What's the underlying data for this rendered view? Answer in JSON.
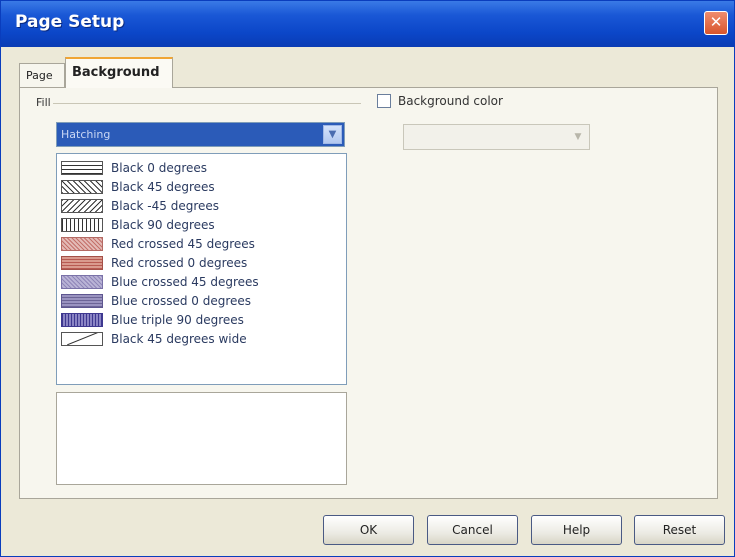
{
  "window": {
    "title": "Page Setup",
    "close_glyph": "✕"
  },
  "tabs": [
    {
      "label": "Page",
      "active": false
    },
    {
      "label": "Background",
      "active": true
    }
  ],
  "fill": {
    "label": "Fill",
    "type_selected": "Hatching",
    "items": [
      {
        "label": "Black 0 degrees",
        "pattern": "black-0"
      },
      {
        "label": "Black 45 degrees",
        "pattern": "black-45"
      },
      {
        "label": "Black -45 degrees",
        "pattern": "black-minus-45"
      },
      {
        "label": "Black 90 degrees",
        "pattern": "black-90"
      },
      {
        "label": "Red crossed 45 degrees",
        "pattern": "red-crossed-45"
      },
      {
        "label": "Red crossed 0 degrees",
        "pattern": "red-crossed-0"
      },
      {
        "label": "Blue crossed 45 degrees",
        "pattern": "blue-crossed-45"
      },
      {
        "label": "Blue crossed 0 degrees",
        "pattern": "blue-crossed-0"
      },
      {
        "label": "Blue triple 90 degrees",
        "pattern": "blue-triple-90"
      },
      {
        "label": "Black 45 degrees wide",
        "pattern": "black-45-wide"
      }
    ]
  },
  "background_color": {
    "label": "Background color",
    "checked": false
  },
  "buttons": {
    "ok": "OK",
    "cancel": "Cancel",
    "help": "Help",
    "reset": "Reset"
  },
  "colors": {
    "titlebar": "#0b46c8",
    "dropdown_selection": "#2b5bb8",
    "dialog_bg": "#ece9d8"
  }
}
